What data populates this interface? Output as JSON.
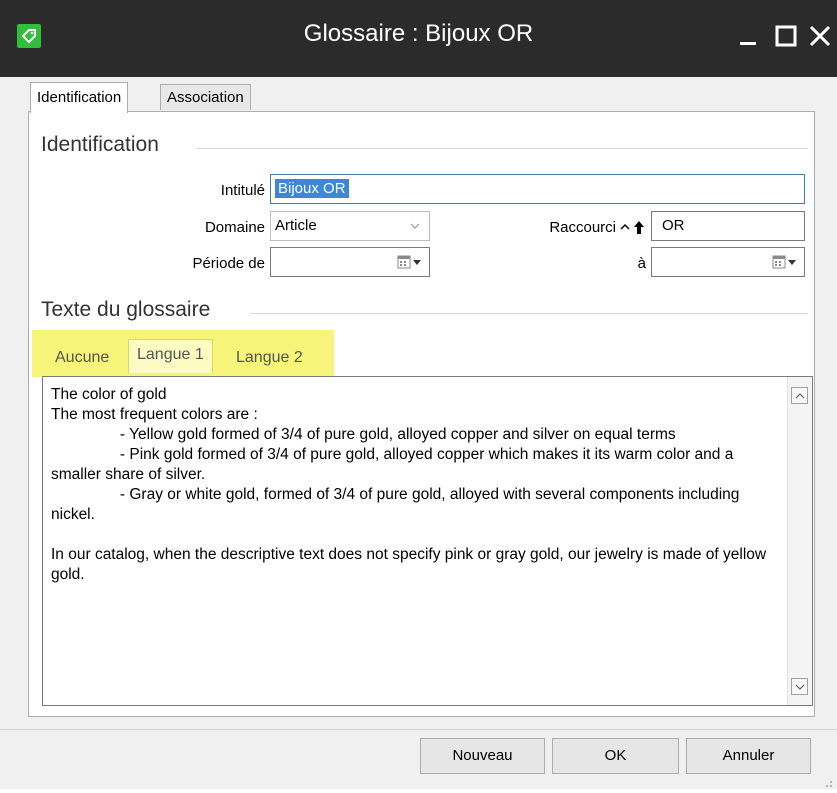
{
  "window": {
    "title": "Glossaire : Bijoux OR",
    "controls": {
      "minimize": "minimize-icon",
      "maximize": "maximize-icon",
      "close": "close-icon"
    }
  },
  "tabs": [
    {
      "label": "Identification",
      "active": true
    },
    {
      "label": "Association",
      "active": false
    }
  ],
  "identification": {
    "group_title": "Identification",
    "intitule_label": "Intitulé",
    "intitule_value": "Bijoux OR",
    "domaine_label": "Domaine",
    "domaine_value": "Article",
    "raccourci_label": "Raccourci",
    "raccourci_value": "OR",
    "periode_label": "Période de",
    "periode_value": "",
    "a_label": "à",
    "a_value": ""
  },
  "glossaire": {
    "group_title": "Texte du glossaire",
    "lang_tabs": [
      {
        "label": "Aucune",
        "active": false
      },
      {
        "label": "Langue 1",
        "active": true
      },
      {
        "label": "Langue 2",
        "active": false
      }
    ],
    "text": "The color of gold\nThe most frequent colors are :\n                - Yellow gold formed of 3/4 of pure gold, alloyed copper and silver on equal terms\n                - Pink gold formed of 3/4 of pure gold, alloyed copper which makes it its warm color and a smaller share of silver.\n                - Gray or white gold, formed of 3/4 of pure gold, alloyed with several components including nickel.\n\nIn our catalog, when the descriptive text does not specify pink or gray gold, our jewelry is made of yellow gold."
  },
  "buttons": {
    "nouveau": "Nouveau",
    "ok": "OK",
    "annuler": "Annuler"
  },
  "colors": {
    "titlebar": "#2b2b2b",
    "app_icon": "#2fbf3a",
    "highlight": "#f6f57a",
    "selection": "#3b88d8"
  }
}
